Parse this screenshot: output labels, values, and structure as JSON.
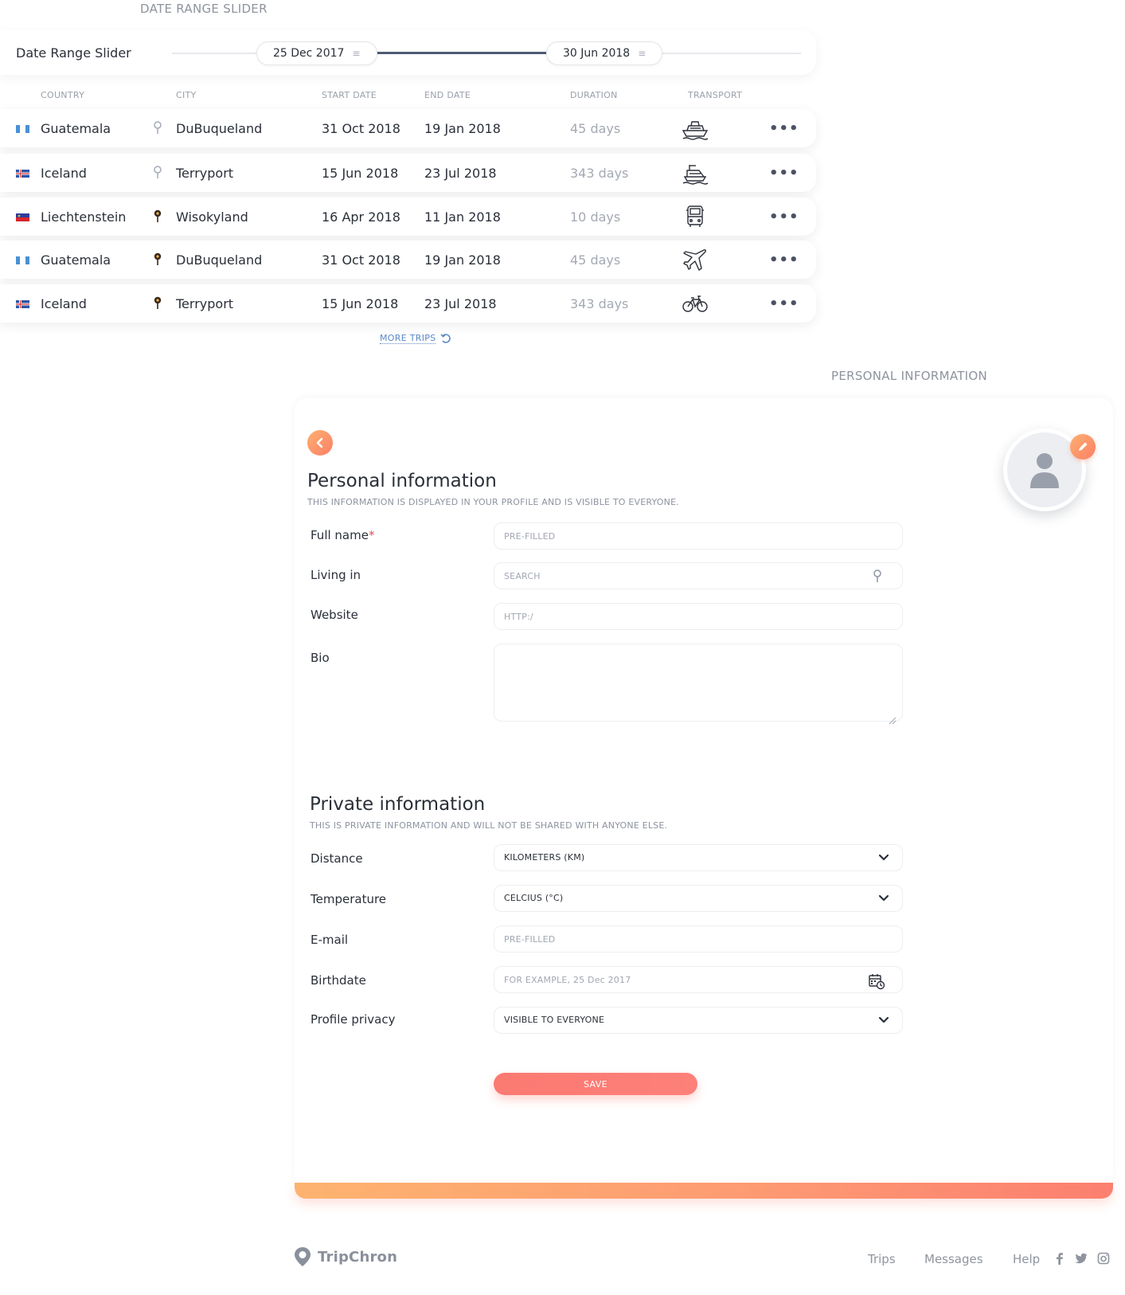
{
  "captions": {
    "date_range": "DATE RANGE SLIDER",
    "personal": "PERSONAL INFORMATION"
  },
  "slider": {
    "label": "Date Range Slider",
    "start": "25 Dec 2017",
    "end": "30 Jun 2018",
    "grip_glyph": "≡"
  },
  "table": {
    "headers": [
      "COUNTRY",
      "CITY",
      "START DATE",
      "END DATE",
      "DURATION",
      "TRANSPORT"
    ],
    "rows": [
      {
        "flag": "guatemala-flag",
        "country": "Guatemala",
        "pin": "pin-outline-icon",
        "city": "DuBuqueland",
        "start": "31 Oct 2018",
        "end": "19 Jan 2018",
        "duration": "45 days",
        "transport": "cruise-ship-icon"
      },
      {
        "flag": "iceland-flag",
        "country": "Iceland",
        "pin": "pin-outline-icon",
        "city": "Terryport",
        "start": "15 Jun 2018",
        "end": "23 Jul 2018",
        "duration": "343 days",
        "transport": "ferry-icon"
      },
      {
        "flag": "liechtenstein-flag",
        "country": "Liechtenstein",
        "pin": "pin-filled-icon",
        "city": "Wisokyland",
        "start": "16 Apr 2018",
        "end": "11 Jan 2018",
        "duration": "10 days",
        "transport": "bus-icon"
      },
      {
        "flag": "guatemala-flag",
        "country": "Guatemala",
        "pin": "pin-filled-icon",
        "city": "DuBuqueland",
        "start": "31 Oct 2018",
        "end": "19 Jan 2018",
        "duration": "45 days",
        "transport": "airplane-icon"
      },
      {
        "flag": "iceland-flag",
        "country": "Iceland",
        "pin": "pin-filled-icon",
        "city": "Terryport",
        "start": "15 Jun 2018",
        "end": "23 Jul 2018",
        "duration": "343 days",
        "transport": "bicycle-icon"
      }
    ],
    "more_glyph": "•••",
    "more_trips": "MORE TRIPS"
  },
  "personal": {
    "title": "Personal information",
    "subtitle": "THIS INFORMATION IS DISPLAYED IN YOUR PROFILE AND IS VISIBLE TO EVERYONE.",
    "fullname_label": "Full name",
    "required_mark": "*",
    "fullname_placeholder": "PRE-FILLED",
    "living_label": "Living in",
    "living_placeholder": "SEARCH",
    "website_label": "Website",
    "website_placeholder": "HTTP:/",
    "bio_label": "Bio"
  },
  "private": {
    "title": "Private information",
    "subtitle": "THIS IS PRIVATE INFORMATION AND WILL NOT BE SHARED WITH ANYONE ELSE.",
    "distance_label": "Distance",
    "distance_value": "KILOMETERS (KM)",
    "temperature_label": "Temperature",
    "temperature_value": "CELCIUS (°C)",
    "email_label": "E-mail",
    "email_placeholder": "PRE-FILLED",
    "birthdate_label": "Birthdate",
    "birthdate_placeholder": "FOR EXAMPLE, 25 Dec 2017",
    "privacy_label": "Profile privacy",
    "privacy_value": "VISIBLE TO EVERYONE",
    "save": "SAVE"
  },
  "footer": {
    "brand": "TripChron",
    "links": [
      "Trips",
      "Messages",
      "Help"
    ],
    "social": [
      "facebook-icon",
      "twitter-icon",
      "instagram-icon"
    ]
  },
  "colors": {
    "accent_orange": "#fb7f66",
    "save_red": "#fb7a72",
    "link_blue": "#5b89c4",
    "slider_active": "#4f5b73"
  }
}
